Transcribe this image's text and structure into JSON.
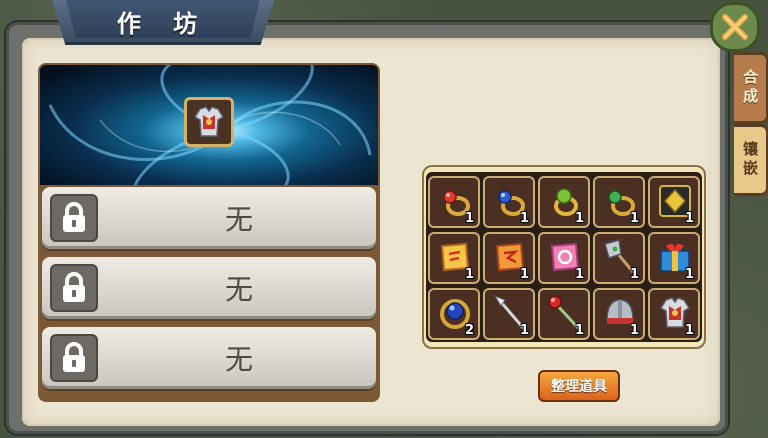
{
  "window": {
    "title": "作 坊"
  },
  "tabs": [
    {
      "label": "合成",
      "active": false
    },
    {
      "label": "镶嵌",
      "active": true
    }
  ],
  "slots": [
    {
      "text": "无",
      "locked": true
    },
    {
      "text": "无",
      "locked": true
    },
    {
      "text": "无",
      "locked": true
    }
  ],
  "target": {
    "item": "chest-armor-icon"
  },
  "inventory": [
    {
      "icon": "red-gem-ring-icon",
      "qty": "1"
    },
    {
      "icon": "blue-gem-ring-icon",
      "qty": "1"
    },
    {
      "icon": "green-gem-ring-icon",
      "qty": "1"
    },
    {
      "icon": "emerald-ring-icon",
      "qty": "1"
    },
    {
      "icon": "gold-treasure-box-icon",
      "qty": "1"
    },
    {
      "icon": "yellow-scroll-icon",
      "qty": "1"
    },
    {
      "icon": "orange-scroll-icon",
      "qty": "1"
    },
    {
      "icon": "pink-scroll-icon",
      "qty": "1"
    },
    {
      "icon": "battle-axe-icon",
      "qty": "1"
    },
    {
      "icon": "gift-box-icon",
      "qty": "1"
    },
    {
      "icon": "sapphire-amulet-icon",
      "qty": "2"
    },
    {
      "icon": "spear-icon",
      "qty": "1"
    },
    {
      "icon": "ruby-staff-icon",
      "qty": "1"
    },
    {
      "icon": "helmet-icon",
      "qty": "1"
    },
    {
      "icon": "chest-armor-icon",
      "qty": "1"
    }
  ],
  "sort_button": {
    "label": "整理道具"
  },
  "colors": {
    "accent": "#e07a2a",
    "tab_active": "#e8c989",
    "tab_inactive": "#b77c4c"
  }
}
